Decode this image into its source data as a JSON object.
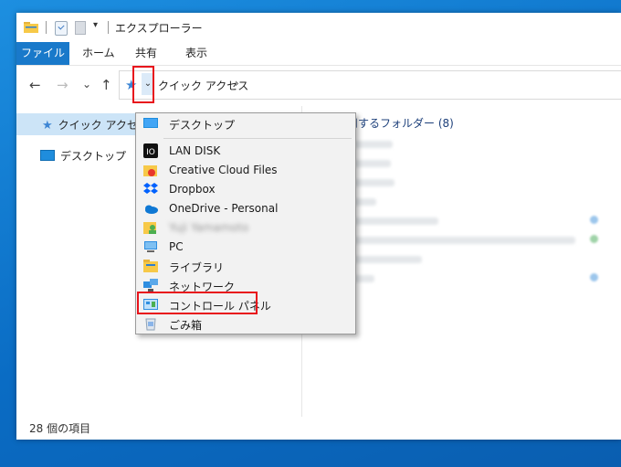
{
  "window": {
    "title": "エクスプローラー"
  },
  "ribbon": {
    "tabs": [
      {
        "label": "ファイル",
        "active": true
      },
      {
        "label": "ホーム"
      },
      {
        "label": "共有"
      },
      {
        "label": "表示"
      }
    ]
  },
  "nav": {
    "back_icon": "←",
    "forward_icon": "→",
    "history_icon": "⌄",
    "up_icon": "↑"
  },
  "address": {
    "chevron_icon": "⌄",
    "location": "クイック アクセス",
    "arrow": "›"
  },
  "nav_pane": {
    "quick_access_label": "クイック アクセス",
    "desktop_label": "デスクトップ"
  },
  "content": {
    "frequent_header": "使用するフォルダー (8)"
  },
  "status": {
    "item_count": "28 個の項目"
  },
  "dropdown": {
    "items": [
      {
        "label": "デスクトップ",
        "icon": "desktop-icon"
      },
      {
        "label": "LAN DISK",
        "icon": "lan-disk-icon"
      },
      {
        "label": "Creative Cloud Files",
        "icon": "creative-cloud-icon"
      },
      {
        "label": "Dropbox",
        "icon": "dropbox-icon"
      },
      {
        "label": "OneDrive - Personal",
        "icon": "onedrive-icon"
      },
      {
        "label": "Yuji Yamamoto",
        "icon": "user-folder-icon"
      },
      {
        "label": "PC",
        "icon": "pc-icon"
      },
      {
        "label": "ライブラリ",
        "icon": "library-icon"
      },
      {
        "label": "ネットワーク",
        "icon": "network-icon"
      },
      {
        "label": "コントロール パネル",
        "icon": "control-panel-icon"
      },
      {
        "label": "ごみ箱",
        "icon": "recycle-bin-icon"
      }
    ]
  },
  "colors": {
    "accent": "#1979ca",
    "highlight": "#e8141c",
    "selection": "#cce4f7"
  }
}
